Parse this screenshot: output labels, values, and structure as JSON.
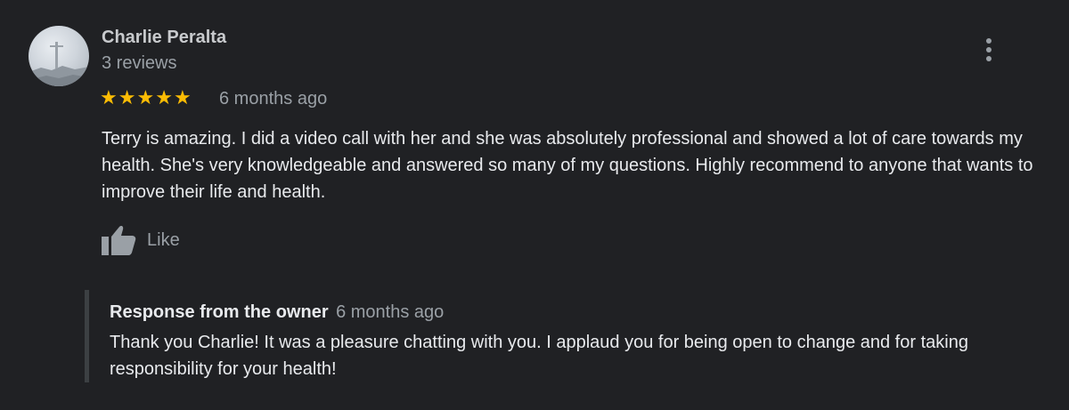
{
  "review": {
    "author_name": "Charlie Peralta",
    "review_count": "3 reviews",
    "rating": 5,
    "stars": [
      "★",
      "★",
      "★",
      "★",
      "★"
    ],
    "date": "6 months ago",
    "text": "Terry is amazing. I did a video call with her and she was absolutely professional and showed a lot of care towards my health. She's very knowledgeable and answered so many of my questions. Highly recommend to anyone that wants to improve their life and health.",
    "like_label": "Like",
    "more_icon": "more-vert-icon",
    "like_icon": "thumbs-up-icon"
  },
  "owner_response": {
    "title": "Response from the owner",
    "date": "6 months ago",
    "text": "Thank you Charlie! It was a pleasure chatting with you. I applaud you for being open to change and for taking responsibility for your health!"
  },
  "colors": {
    "background": "#202124",
    "star": "#fbbc04",
    "primary_text": "#e8eaed",
    "secondary_text": "#9aa0a6",
    "response_border": "#3c4043"
  }
}
